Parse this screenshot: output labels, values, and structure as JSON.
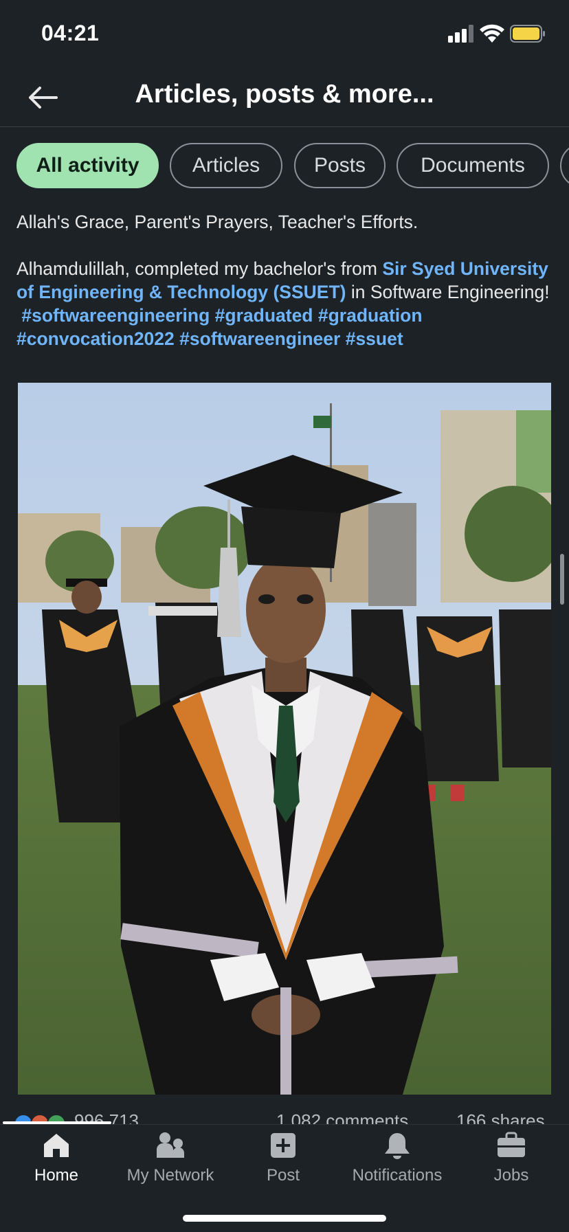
{
  "status": {
    "time": "04:21"
  },
  "header": {
    "title": "Articles, posts & more..."
  },
  "chips": [
    {
      "label": "All activity",
      "active": true
    },
    {
      "label": "Articles",
      "active": false
    },
    {
      "label": "Posts",
      "active": false
    },
    {
      "label": "Documents",
      "active": false
    }
  ],
  "post": {
    "line1": "Allah's Grace, Parent's Prayers, Teacher's Efforts.",
    "line2_prefix": "Alhamdulillah, completed my bachelor's from ",
    "university_link": "Sir Syed University of Engineering & Technology (SSUET)",
    "line2_suffix": " in Software Engineering!",
    "hashtags": [
      "#softwareengineering",
      "#graduated",
      "#graduation",
      "#convocation2022",
      "#softwareengineer",
      "#ssuet"
    ]
  },
  "social": {
    "reactions_count": "996,713",
    "comments": "1,082 comments",
    "shares": "166 shares"
  },
  "tabbar": {
    "items": [
      {
        "label": "Home",
        "icon": "home-icon",
        "active": true
      },
      {
        "label": "My Network",
        "icon": "people-icon",
        "active": false
      },
      {
        "label": "Post",
        "icon": "plus-square-icon",
        "active": false
      },
      {
        "label": "Notifications",
        "icon": "bell-icon",
        "active": false
      },
      {
        "label": "Jobs",
        "icon": "briefcase-icon",
        "active": false
      }
    ]
  },
  "colors": {
    "background": "#1d2226",
    "accent_chip": "#a1e3b0",
    "link": "#70b5f9",
    "battery": "#f5d547"
  }
}
